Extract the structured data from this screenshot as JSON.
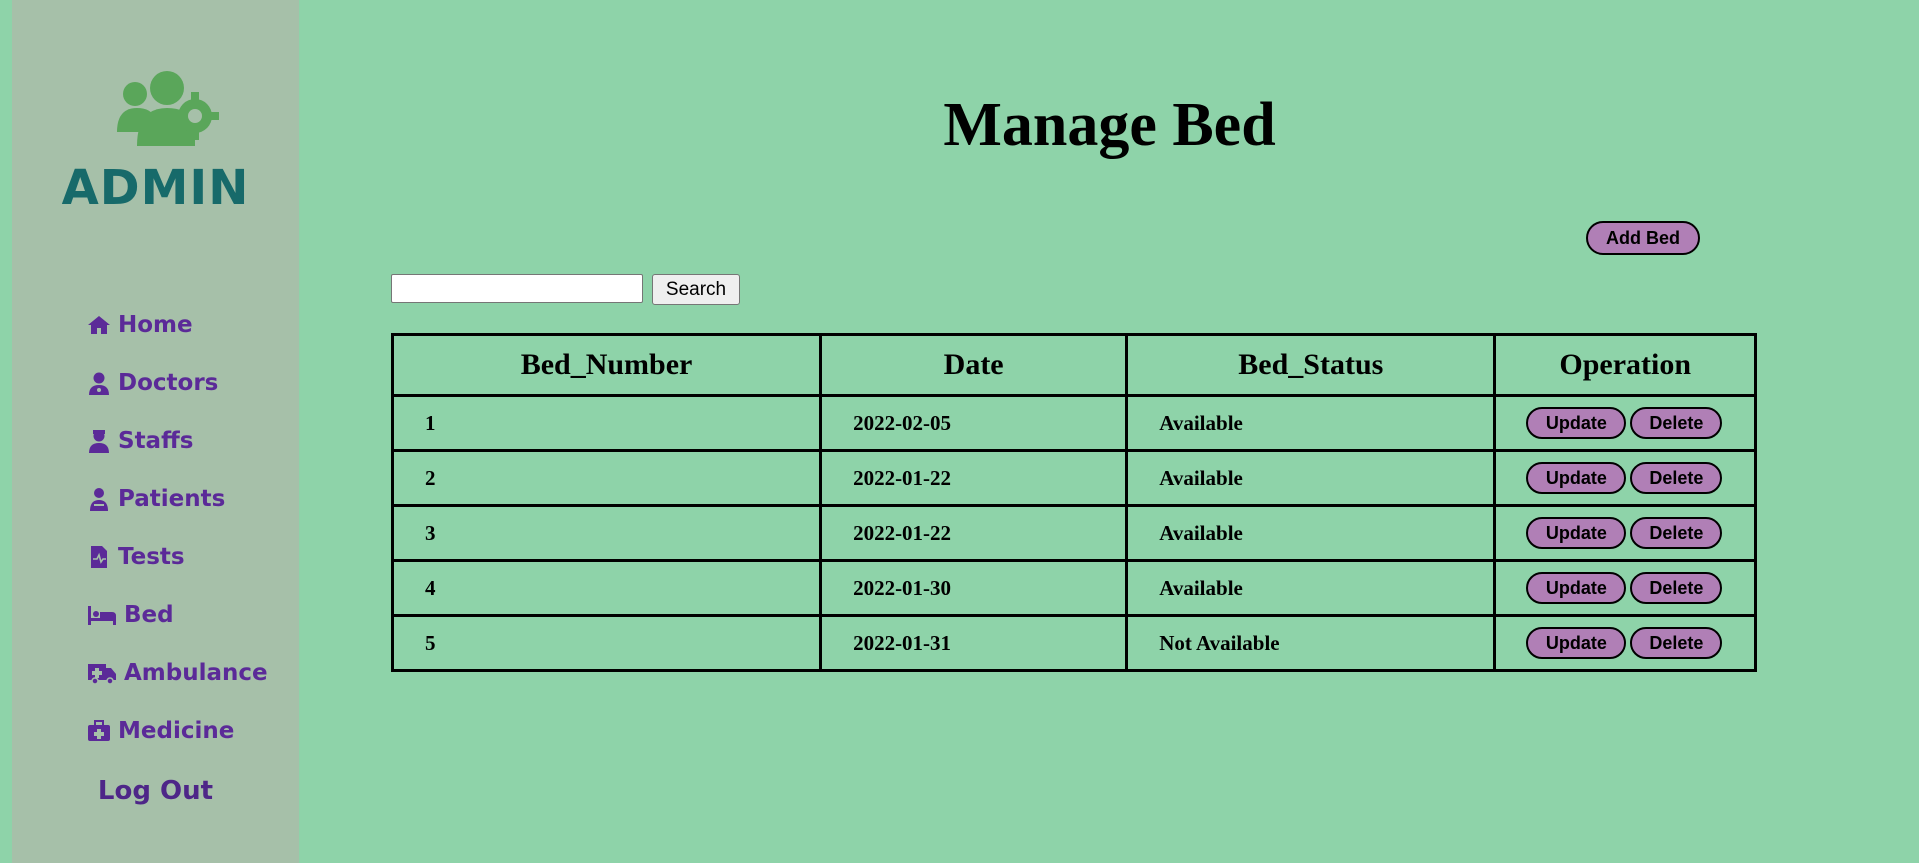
{
  "sidebar": {
    "logo_text": "ADMIN",
    "items": [
      {
        "label": "Home",
        "icon": "home-icon"
      },
      {
        "label": "Doctors",
        "icon": "doctor-icon"
      },
      {
        "label": "Staffs",
        "icon": "staff-icon"
      },
      {
        "label": "Patients",
        "icon": "patient-icon"
      },
      {
        "label": "Tests",
        "icon": "file-medical-icon"
      },
      {
        "label": "Bed",
        "icon": "bed-icon"
      },
      {
        "label": "Ambulance",
        "icon": "ambulance-icon"
      },
      {
        "label": "Medicine",
        "icon": "medkit-icon"
      }
    ],
    "logout_label": "Log Out"
  },
  "main": {
    "title": "Manage Bed",
    "add_button_label": "Add Bed",
    "search": {
      "value": "",
      "placeholder": "",
      "button_label": "Search"
    },
    "table": {
      "headers": [
        "Bed_Number",
        "Date",
        "Bed_Status",
        "Operation"
      ],
      "rows": [
        {
          "bed_number": "1",
          "date": "2022-02-05",
          "status": "Available",
          "update_label": "Update",
          "delete_label": "Delete"
        },
        {
          "bed_number": "2",
          "date": "2022-01-22",
          "status": "Available",
          "update_label": "Update",
          "delete_label": "Delete"
        },
        {
          "bed_number": "3",
          "date": "2022-01-22",
          "status": "Available",
          "update_label": "Update",
          "delete_label": "Delete"
        },
        {
          "bed_number": "4",
          "date": "2022-01-30",
          "status": "Available",
          "update_label": "Update",
          "delete_label": "Delete"
        },
        {
          "bed_number": "5",
          "date": "2022-01-31",
          "status": "Not Available",
          "update_label": "Update",
          "delete_label": "Delete"
        }
      ]
    }
  },
  "colors": {
    "background": "#8ed3a9",
    "sidebar": "#a6c0a9",
    "logo_icon": "#5aa65a",
    "logo_text": "#176a6a",
    "nav_text": "#5b2a98",
    "button": "#b07fb6"
  }
}
